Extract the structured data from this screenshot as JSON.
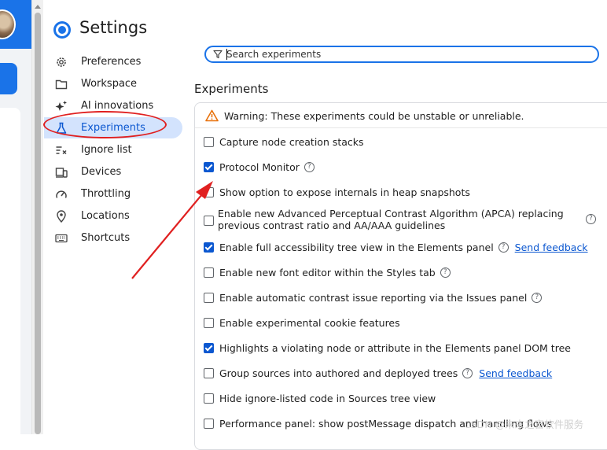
{
  "header": {
    "title": "Settings"
  },
  "nav": {
    "items": [
      {
        "label": "Preferences",
        "icon": "gear-icon"
      },
      {
        "label": "Workspace",
        "icon": "folder-icon"
      },
      {
        "label": "AI innovations",
        "icon": "sparkle-icon"
      },
      {
        "label": "Experiments",
        "icon": "flask-icon",
        "active": true
      },
      {
        "label": "Ignore list",
        "icon": "ignore-list-icon"
      },
      {
        "label": "Devices",
        "icon": "devices-icon"
      },
      {
        "label": "Throttling",
        "icon": "speedometer-icon"
      },
      {
        "label": "Locations",
        "icon": "location-pin-icon"
      },
      {
        "label": "Shortcuts",
        "icon": "keyboard-icon"
      }
    ]
  },
  "search": {
    "placeholder": "Search experiments",
    "value": ""
  },
  "section_title": "Experiments",
  "warning": "Warning: These experiments could be unstable or unreliable.",
  "experiments": [
    {
      "label": "Capture node creation stacks",
      "checked": false
    },
    {
      "label": "Protocol Monitor",
      "checked": true,
      "help": true
    },
    {
      "label": "Show option to expose internals in heap snapshots",
      "checked": false
    },
    {
      "label": "Enable new Advanced Perceptual Contrast Algorithm (APCA) replacing previous contrast ratio and AA/AAA guidelines",
      "checked": false,
      "help": true
    },
    {
      "label": "Enable full accessibility tree view in the Elements panel",
      "checked": true,
      "help": true,
      "link": "Send feedback"
    },
    {
      "label": "Enable new font editor within the Styles tab",
      "checked": false,
      "help": true
    },
    {
      "label": "Enable automatic contrast issue reporting via the Issues panel",
      "checked": false,
      "help": true
    },
    {
      "label": "Enable experimental cookie features",
      "checked": false
    },
    {
      "label": "Highlights a violating node or attribute in the Elements panel DOM tree",
      "checked": true
    },
    {
      "label": "Group sources into authored and deployed trees",
      "checked": false,
      "help": true,
      "link": "Send feedback"
    },
    {
      "label": "Hide ignore-listed code in Sources tree view",
      "checked": false
    },
    {
      "label": "Performance panel: show postMessage dispatch and handling flows",
      "checked": false
    }
  ],
  "watermark": "CSDN @未末之宙软件服务",
  "colors": {
    "accent": "#1a73e8",
    "active_bg": "#d3e3fd",
    "annotation": "#e02020",
    "warning": "#e8710a"
  }
}
